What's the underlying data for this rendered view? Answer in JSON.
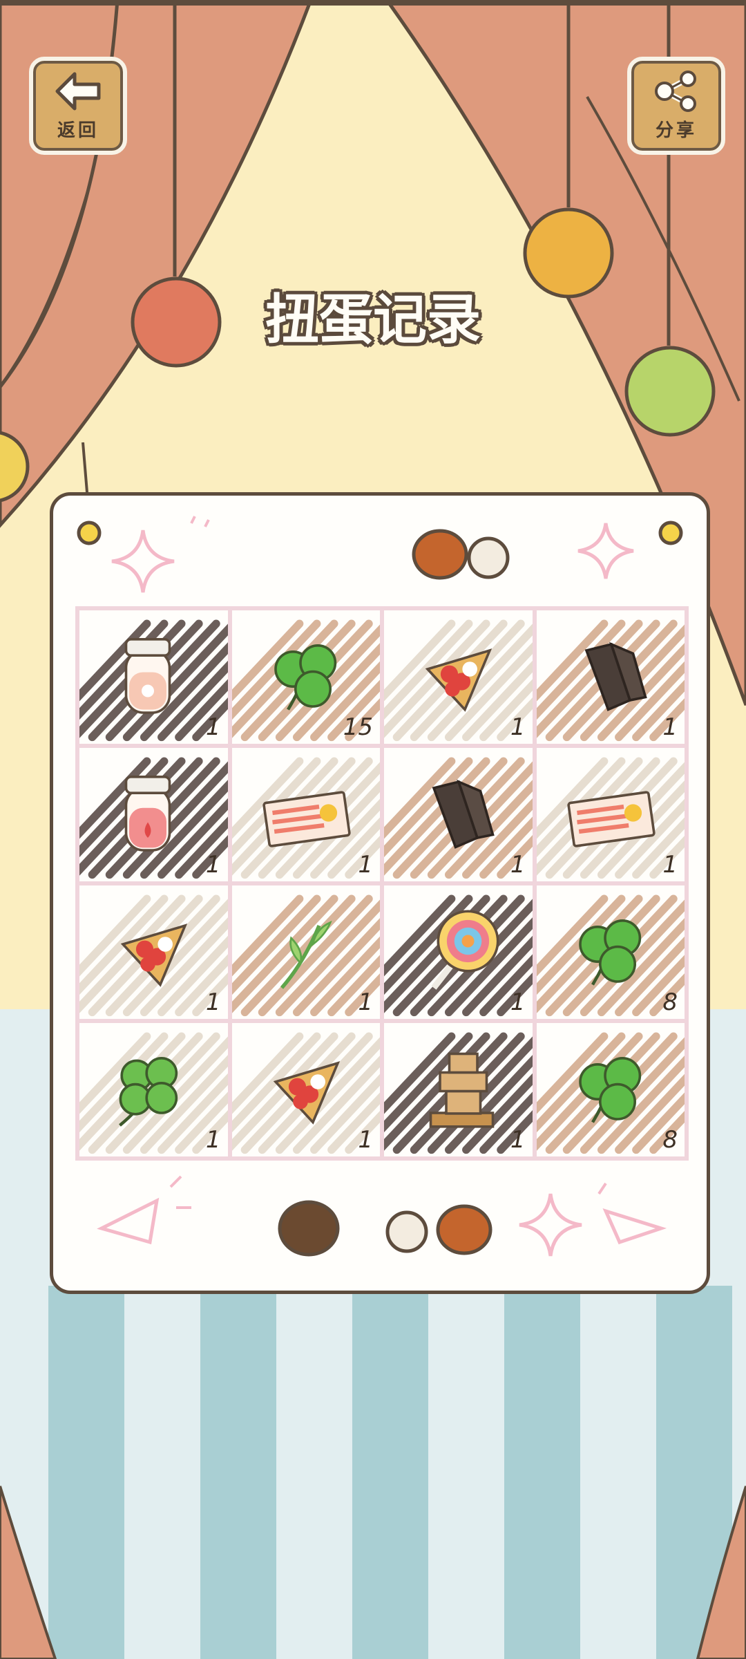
{
  "header": {
    "back_label": "返回",
    "share_label": "分享",
    "title": "扭蛋记录"
  },
  "grid": {
    "items": [
      {
        "item": "peach-jam-jar-icon",
        "count": "1",
        "scribble": "#6b5e5a"
      },
      {
        "item": "three-leaf-clover-icon",
        "count": "15",
        "scribble": "#d8b49a"
      },
      {
        "item": "strawberry-crepe-icon",
        "count": "1",
        "scribble": "#e6ddd0"
      },
      {
        "item": "charred-wood-icon",
        "count": "1",
        "scribble": "#d8b49a"
      },
      {
        "item": "strawberry-jam-jar-icon",
        "count": "1",
        "scribble": "#6b5e5a"
      },
      {
        "item": "rising-sun-ticket-icon",
        "count": "1",
        "scribble": "#e6ddd0"
      },
      {
        "item": "charred-wood-icon",
        "count": "1",
        "scribble": "#d8b49a"
      },
      {
        "item": "rising-sun-ticket-icon",
        "count": "1",
        "scribble": "#e6ddd0"
      },
      {
        "item": "strawberry-crepe-icon",
        "count": "1",
        "scribble": "#e6ddd0"
      },
      {
        "item": "green-sprout-icon",
        "count": "1",
        "scribble": "#d8b49a"
      },
      {
        "item": "swirl-lollipop-icon",
        "count": "1",
        "scribble": "#6b5e5a"
      },
      {
        "item": "three-leaf-clover-icon",
        "count": "8",
        "scribble": "#d8b49a"
      },
      {
        "item": "four-leaf-clover-icon",
        "count": "1",
        "scribble": "#e6ddd0"
      },
      {
        "item": "strawberry-crepe-icon",
        "count": "1",
        "scribble": "#e6ddd0"
      },
      {
        "item": "stone-tower-icon",
        "count": "1",
        "scribble": "#6b5e5a"
      },
      {
        "item": "three-leaf-clover-icon",
        "count": "8",
        "scribble": "#d8b49a"
      }
    ]
  },
  "colors": {
    "curtain": "#de9a7d",
    "wall": "#fbeec0",
    "floor_light": "#e2eef0",
    "floor_dark": "#a9cfd3",
    "outline": "#5d4c3d"
  }
}
